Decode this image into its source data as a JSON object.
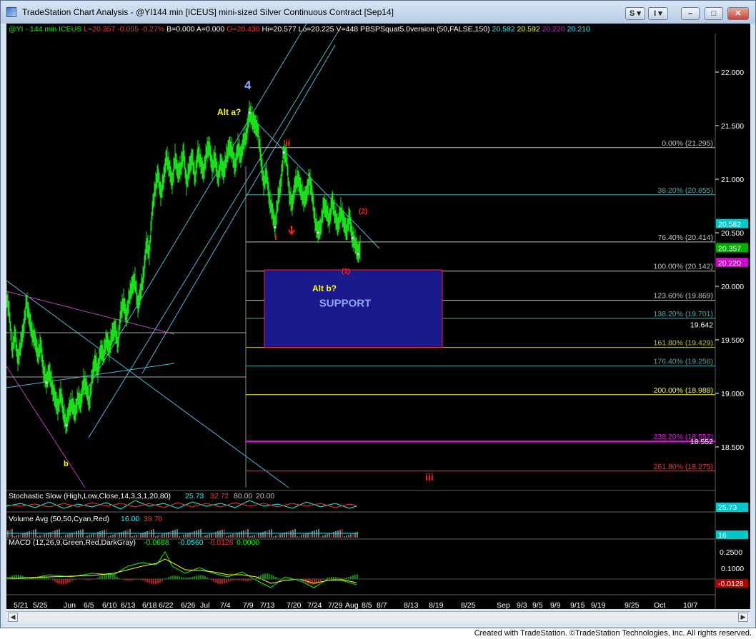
{
  "window": {
    "title": "TradeStation Chart Analysis - @YI144 min [ICEUS] mini-sized Silver Continuous Contract [Sep14]"
  },
  "toolbar": {
    "s_label": "S",
    "i_label": "I",
    "minimize_label": "–",
    "maximize_label": "□",
    "close_label": "✕"
  },
  "status_bar": {
    "items": [
      {
        "text": "@YI - 144 min",
        "color": "#00ff00"
      },
      {
        "text": "ICEUS",
        "color": "#00ff00"
      },
      {
        "text": "L=20.357",
        "color": "#ff3030"
      },
      {
        "text": "-0.055",
        "color": "#ff3030"
      },
      {
        "text": "-0.27%",
        "color": "#ff3030"
      },
      {
        "text": "B=0.000",
        "color": "#ffffff"
      },
      {
        "text": "A=0.000",
        "color": "#ffffff"
      },
      {
        "text": "O=20.430",
        "color": "#ff3030"
      },
      {
        "text": "Hi=20.577",
        "color": "#ffffff"
      },
      {
        "text": "Lo=20.225",
        "color": "#ffffff"
      },
      {
        "text": "V=448",
        "color": "#ffffff"
      },
      {
        "text": "PBSPSquat5.0version (50,FALSE,150)",
        "color": "#ffffff"
      },
      {
        "text": "20.582",
        "color": "#00ffff"
      },
      {
        "text": "20.592",
        "color": "#ffff00"
      },
      {
        "text": "20.220",
        "color": "#ff00ff"
      },
      {
        "text": "20.210",
        "color": "#00ffff"
      }
    ]
  },
  "chart_data": {
    "type": "line",
    "instrument": "@YI 144 min mini-sized Silver Continuous Contract [Sep14]",
    "price_axis": {
      "ticks": [
        "22.000",
        "21.500",
        "21.000",
        "20.500",
        "20.000",
        "19.500",
        "19.000",
        "18.500"
      ],
      "range": [
        18.2,
        22.35
      ]
    },
    "axis_price_labels": [
      {
        "text": "20.582",
        "price": 20.582,
        "bg": "#00c8c8",
        "fg": "#ffffff"
      },
      {
        "text": "20.357",
        "price": 20.357,
        "bg": "#00b000",
        "fg": "#ffffff"
      },
      {
        "text": "20.220",
        "price": 20.22,
        "bg": "#d000d0",
        "fg": "#ffffff"
      }
    ],
    "x_axis_labels": [
      "5/21",
      "5/25",
      "Jun",
      "6/5",
      "6/10",
      "6/13",
      "6/18",
      "6/22",
      "6/26",
      "Jul",
      "7/4",
      "7/9",
      "7/13",
      "7/20",
      "7/24",
      "7/29",
      "Aug",
      "8/5",
      "8/7",
      "8/13",
      "8/19",
      "8/25",
      "Sep",
      "9/3",
      "9/5",
      "9/9",
      "9/15",
      "9/19",
      "9/25",
      "Oct",
      "10/7"
    ],
    "fib_levels": [
      {
        "label": "0.00% (21.295)",
        "price": 21.295,
        "color": "#c0c0c0"
      },
      {
        "label": "38.20% (20.855)",
        "price": 20.855,
        "color": "#40b0b0"
      },
      {
        "label": "76.40% (20.414)",
        "price": 20.414,
        "color": "#c0c0c0"
      },
      {
        "label": "100.00% (20.142)",
        "price": 20.142,
        "color": "#c0c0c0"
      },
      {
        "label": "123.60% (19.869)",
        "price": 19.869,
        "color": "#c0c0c0"
      },
      {
        "label": "138.20% (19.701)",
        "price": 19.701,
        "color": "#40b0b0"
      },
      {
        "label": "161.80% (19.429)",
        "price": 19.429,
        "color": "#c8c800"
      },
      {
        "label": "176.40% (19.256)",
        "price": 19.256,
        "color": "#40b0b0"
      },
      {
        "label": "200.00% (18.988)",
        "price": 18.988,
        "color": "#ffff00"
      },
      {
        "label": "238.20% (18.552)",
        "price": 18.552,
        "color": "#ff00ff"
      },
      {
        "label": "261.80% (18.275)",
        "price": 18.275,
        "color": "#ff3030"
      }
    ],
    "extra_price_labels": [
      {
        "text": "19.642",
        "price": 19.642
      },
      {
        "text": "18.552",
        "price": 18.552
      }
    ],
    "support_box": {
      "label": "SUPPORT",
      "top": 20.22,
      "bottom": 19.43,
      "fill": "#1a1a8c",
      "border": "#ff2020"
    },
    "annotations": [
      {
        "text": "4",
        "color": "#88aaff"
      },
      {
        "text": "Alt a?",
        "color": "#ffff00"
      },
      {
        "text": "ii",
        "color": "#ff2020"
      },
      {
        "text": "i",
        "color": "#ff2020"
      },
      {
        "text": "(2)",
        "color": "#ff2020"
      },
      {
        "text": "(1)",
        "color": "#ff2020"
      },
      {
        "text": "Alt b?",
        "color": "#ffff00"
      },
      {
        "text": "b",
        "color": "#ffff00"
      },
      {
        "text": "iii",
        "color": "#ff2020"
      }
    ],
    "price_series": [
      [
        0,
        19.9
      ],
      [
        4,
        19.75
      ],
      [
        8,
        19.4
      ],
      [
        12,
        19.55
      ],
      [
        16,
        19.3
      ],
      [
        20,
        19.45
      ],
      [
        24,
        19.6
      ],
      [
        28,
        19.85
      ],
      [
        32,
        19.7
      ],
      [
        36,
        19.55
      ],
      [
        40,
        19.5
      ],
      [
        44,
        19.35
      ],
      [
        48,
        19.45
      ],
      [
        52,
        19.2
      ],
      [
        56,
        19.1
      ],
      [
        60,
        19.2
      ],
      [
        64,
        19.05
      ],
      [
        68,
        18.95
      ],
      [
        72,
        18.85
      ],
      [
        76,
        19.0
      ],
      [
        80,
        18.8
      ],
      [
        84,
        18.7
      ],
      [
        88,
        18.85
      ],
      [
        92,
        18.9
      ],
      [
        96,
        18.8
      ],
      [
        100,
        18.95
      ],
      [
        104,
        18.9
      ],
      [
        108,
        19.1
      ],
      [
        112,
        19.05
      ],
      [
        116,
        18.9
      ],
      [
        120,
        19.15
      ],
      [
        124,
        19.3
      ],
      [
        128,
        19.2
      ],
      [
        132,
        19.4
      ],
      [
        136,
        19.35
      ],
      [
        140,
        19.5
      ],
      [
        144,
        19.4
      ],
      [
        148,
        19.55
      ],
      [
        152,
        19.6
      ],
      [
        156,
        19.45
      ],
      [
        160,
        19.75
      ],
      [
        164,
        19.85
      ],
      [
        168,
        19.7
      ],
      [
        172,
        19.9
      ],
      [
        176,
        20.0
      ],
      [
        180,
        20.05
      ],
      [
        184,
        19.8
      ],
      [
        188,
        19.95
      ],
      [
        192,
        20.1
      ],
      [
        196,
        20.4
      ],
      [
        200,
        20.3
      ],
      [
        204,
        20.7
      ],
      [
        208,
        20.9
      ],
      [
        212,
        21.05
      ],
      [
        216,
        20.85
      ],
      [
        220,
        21.0
      ],
      [
        224,
        21.2
      ],
      [
        228,
        21.1
      ],
      [
        232,
        20.95
      ],
      [
        236,
        21.2
      ],
      [
        240,
        21.05
      ],
      [
        244,
        21.1
      ],
      [
        248,
        21.25
      ],
      [
        252,
        20.95
      ],
      [
        256,
        21.1
      ],
      [
        260,
        21.2
      ],
      [
        264,
        21.0
      ],
      [
        268,
        21.25
      ],
      [
        272,
        21.15
      ],
      [
        276,
        21.05
      ],
      [
        280,
        21.25
      ],
      [
        284,
        21.3
      ],
      [
        288,
        21.1
      ],
      [
        292,
        21.2
      ],
      [
        296,
        21.0
      ],
      [
        300,
        21.15
      ],
      [
        304,
        21.05
      ],
      [
        308,
        21.2
      ],
      [
        312,
        21.3
      ],
      [
        316,
        21.25
      ],
      [
        320,
        21.1
      ],
      [
        324,
        21.3
      ],
      [
        328,
        21.2
      ],
      [
        332,
        21.35
      ],
      [
        336,
        21.4
      ],
      [
        340,
        21.62
      ],
      [
        344,
        21.55
      ],
      [
        348,
        21.5
      ],
      [
        352,
        21.45
      ],
      [
        356,
        21.2
      ],
      [
        360,
        20.95
      ],
      [
        364,
        21.05
      ],
      [
        368,
        20.8
      ],
      [
        372,
        20.7
      ],
      [
        376,
        20.55
      ],
      [
        380,
        20.8
      ],
      [
        384,
        20.95
      ],
      [
        388,
        21.25
      ],
      [
        392,
        21.2
      ],
      [
        396,
        20.85
      ],
      [
        400,
        20.75
      ],
      [
        404,
        20.95
      ],
      [
        408,
        21.0
      ],
      [
        412,
        20.9
      ],
      [
        416,
        20.8
      ],
      [
        420,
        20.85
      ],
      [
        424,
        21.0
      ],
      [
        428,
        20.85
      ],
      [
        432,
        20.6
      ],
      [
        436,
        20.5
      ],
      [
        440,
        20.55
      ],
      [
        444,
        20.75
      ],
      [
        448,
        20.7
      ],
      [
        452,
        20.6
      ],
      [
        456,
        20.8
      ],
      [
        460,
        20.65
      ],
      [
        464,
        20.55
      ],
      [
        468,
        20.7
      ],
      [
        472,
        20.6
      ],
      [
        476,
        20.5
      ],
      [
        480,
        20.65
      ],
      [
        484,
        20.45
      ],
      [
        488,
        20.4
      ],
      [
        492,
        20.3
      ],
      [
        496,
        20.36
      ]
    ]
  },
  "indicators": {
    "stochastic": {
      "label": "Stochastic Slow (High,Low,Close,14,3,3,1,20,80)",
      "values": [
        "25.73",
        "32.72",
        "80.00",
        "20.00"
      ],
      "axis_label": "25.73"
    },
    "volume": {
      "label": "Volume Avg (50,50,Cyan,Red)",
      "values": [
        "16.00",
        "39.70"
      ],
      "axis_label": "16"
    },
    "macd": {
      "label": "MACD (12,26,9,Green,Red,DarkGray)",
      "values": [
        "-0.0688",
        "-0.0560",
        "-0.0128",
        "0.0000"
      ],
      "ticks": [
        "0.2500",
        "0.1000",
        "-0.0128"
      ]
    }
  },
  "footer": {
    "text": "Created with TradeStation. ©TradeStation Technologies, Inc. All rights reserved."
  }
}
